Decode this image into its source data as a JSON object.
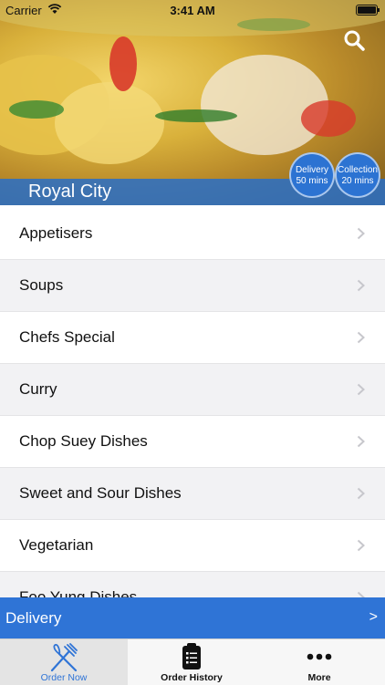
{
  "status": {
    "carrier": "Carrier",
    "time": "3:41 AM"
  },
  "header": {
    "restaurant_name": "Royal City",
    "delivery_badge": {
      "line1": "Delivery",
      "line2": "50 mins"
    },
    "collection_badge": {
      "line1": "Collection",
      "line2": "20 mins"
    }
  },
  "menu": {
    "categories": [
      {
        "label": "Appetisers"
      },
      {
        "label": "Soups"
      },
      {
        "label": "Chefs Special"
      },
      {
        "label": "Curry"
      },
      {
        "label": "Chop Suey Dishes"
      },
      {
        "label": "Sweet and Sour Dishes"
      },
      {
        "label": "Vegetarian"
      },
      {
        "label": "Foo Yung Dishes"
      }
    ]
  },
  "order_bar": {
    "label": "Delivery",
    "arrow": ">"
  },
  "tabs": [
    {
      "label": "Order Now",
      "icon": "fork-knife-icon",
      "active": true
    },
    {
      "label": "Order History",
      "icon": "clipboard-list-icon",
      "active": false
    },
    {
      "label": "More",
      "icon": "more-dots-icon",
      "active": false
    }
  ],
  "colors": {
    "accent": "#2f74d6",
    "band": "#286ec8"
  }
}
